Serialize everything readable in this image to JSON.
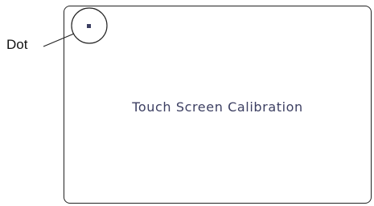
{
  "screen": {
    "title": "Touch Screen Calibration"
  },
  "callout": {
    "label": "Dot"
  },
  "colors": {
    "text": "#3c3f62",
    "border": "#222222",
    "dot": "#3c3f62"
  }
}
